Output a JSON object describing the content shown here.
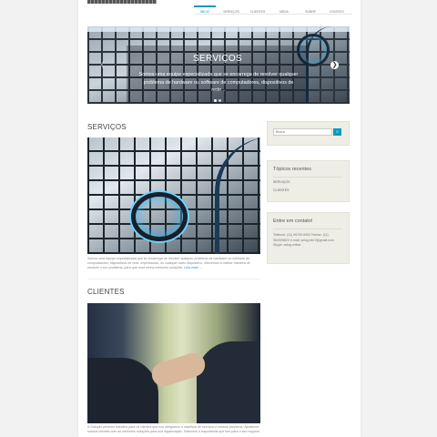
{
  "nav": {
    "items": [
      "Início",
      "Serviços",
      "Clientes",
      "Mídia",
      "Sobre",
      "Contato"
    ]
  },
  "slider": {
    "title": "SERVIÇOS",
    "text": "Somos uma equipe especializada que se encarrega de resolver qualquer problema de hardware ou software de computadores, dispositivos de rede..."
  },
  "posts": [
    {
      "title": "SERVIÇOS",
      "excerpt": "Somos uma equipe especializada que se encarrega de resolver qualquer problema de hardware ou software de computadores, dispositivos de rede, impressoras, ou cualquer outro dispositivo, ofrecemos a melhor maneira de resolver o seu problema, para que você tenha melhores soluções.",
      "more": "Leia mais →"
    },
    {
      "title": "CLIENTES",
      "excerpt": "A Solução primeiro trabalha para os clientes que nos obrigamos a objetivos de serviços e nossos parceiros. Ajudamos nossos clientes com as melhores soluções para sua organização. Sabemos a importância que tem para o seu negócio."
    }
  ],
  "sidebar": {
    "search_placeholder": "Busca",
    "search_icon": "search-icon",
    "recent_title": "Tópicos recentes",
    "recent_items": [
      "SERVIÇOS",
      "CLIENTES"
    ],
    "contact_title": "Entre em contato!",
    "contact_text": "Telefone: (11) 99709-9000 Telefax: (11) 96499982X e-mail: solug.info7@gmail.com Skype: solug.online"
  },
  "colors": {
    "accent": "#0e9ac0",
    "widget_bg": "#eeeee6",
    "background": "#f2f2f2"
  }
}
